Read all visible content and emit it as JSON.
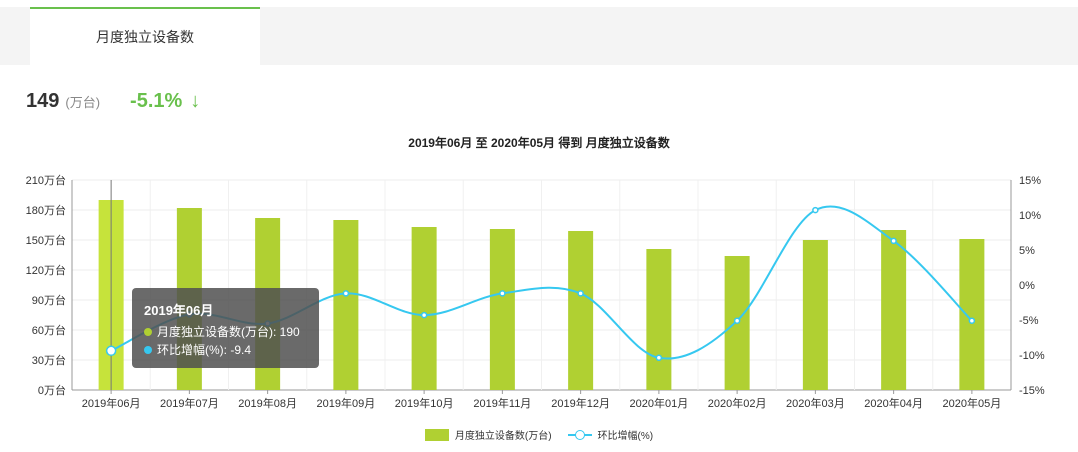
{
  "tab": {
    "label": "月度独立设备数"
  },
  "kpi": {
    "value": "149",
    "unit": "(万台)",
    "change": "-5.1%",
    "arrow": "↓"
  },
  "colors": {
    "bar": "#b0d032",
    "bar_active": "#c6e33b",
    "line": "#36c8f0",
    "accent": "#69c04c"
  },
  "tooltip": {
    "title": "2019年06月",
    "rows": [
      {
        "label": "月度独立设备数(万台): 190",
        "color": "#b0d032"
      },
      {
        "label": "环比增幅(%): -9.4",
        "color": "#36c8f0"
      }
    ]
  },
  "chart_data": {
    "type": "bar",
    "title": "2019年06月 至 2020年05月 得到 月度独立设备数",
    "categories": [
      "2019年06月",
      "2019年07月",
      "2019年08月",
      "2019年09月",
      "2019年10月",
      "2019年11月",
      "2019年12月",
      "2020年01月",
      "2020年02月",
      "2020年03月",
      "2020年04月",
      "2020年05月"
    ],
    "series": [
      {
        "name": "月度独立设备数(万台)",
        "type": "bar",
        "axis": "left",
        "values": [
          190,
          182,
          172,
          170,
          163,
          161,
          159,
          141,
          134,
          150,
          160,
          151
        ]
      },
      {
        "name": "环比增幅(%)",
        "type": "line",
        "axis": "right",
        "values": [
          -9.4,
          -4.2,
          -5.5,
          -1.2,
          -4.3,
          -1.2,
          -1.2,
          -10.4,
          -5.1,
          10.7,
          6.3,
          -5.1
        ]
      }
    ],
    "y_left": {
      "min": 0,
      "max": 210,
      "step": 30,
      "tick_labels": [
        "0万台",
        "30万台",
        "60万台",
        "90万台",
        "120万台",
        "150万台",
        "180万台",
        "210万台"
      ]
    },
    "y_right": {
      "min": -15,
      "max": 15,
      "step": 5,
      "tick_labels": [
        "-15%",
        "-10%",
        "-5%",
        "0%",
        "5%",
        "10%",
        "15%"
      ]
    },
    "active_index": 0,
    "grid": true,
    "legend_position": "bottom"
  }
}
